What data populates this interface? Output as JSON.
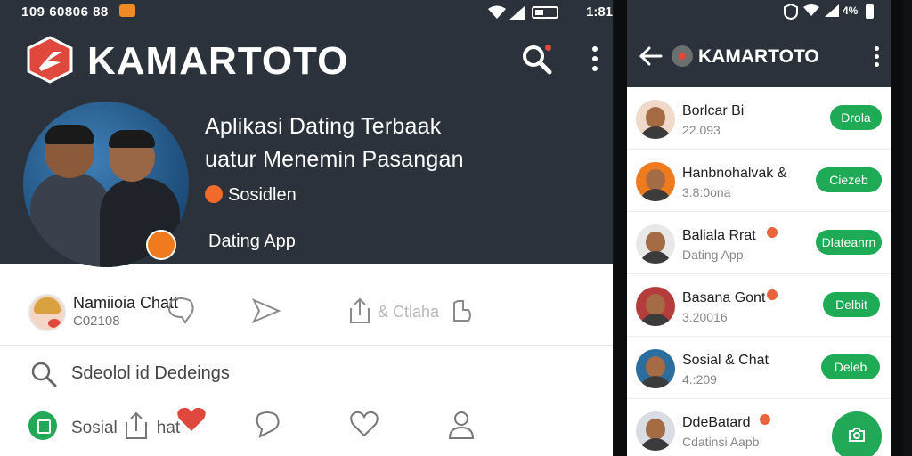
{
  "left": {
    "statusbar": {
      "time": "109 60806 88",
      "notification_color": "#f08a24"
    },
    "header": {
      "brand": "KAMARTOTO",
      "brand_color": "#e0483d",
      "bg_color": "#2c323b",
      "search_icon": "search-icon",
      "menu_icon": "kebab-menu-icon"
    },
    "profile": {
      "tagline_1": "Aplikasi Dating Terbaak",
      "tagline_2": "uatur Menemin Pasangan",
      "status_text": "Sosidlen",
      "category": "Dating App"
    },
    "row1": {
      "name": "Namiioia Chatt",
      "sub": "C02108",
      "share_label": "& Ctlaha"
    },
    "row2": {
      "search_text": "Sdeolol id Dedeings"
    },
    "bottom_nav": {
      "label": "Sosial",
      "label_suffix": "hat"
    }
  },
  "right": {
    "statusbar": {
      "time": "1:81",
      "battery_text": "4%"
    },
    "appbar": {
      "title": "KAMARTOTO"
    },
    "list": [
      {
        "name": "Borlcar Bi",
        "sub": "22.093",
        "button": "Drola",
        "badge": false,
        "avatar_color": "#f0d9c8"
      },
      {
        "name": "Hanbnohalvak &",
        "sub": "3.8:0ona",
        "button": "Ciezeb",
        "badge": false,
        "avatar_color": "#f07a1e"
      },
      {
        "name": "Baliala Rrat",
        "sub": "Dating App",
        "button": "Dlateanrn",
        "badge": true,
        "avatar_color": "#e8e8e8"
      },
      {
        "name": "Basana Gont",
        "sub": "3.20016",
        "button": "Delbit",
        "badge": true,
        "avatar_color": "#b43c3c"
      },
      {
        "name": "Sosial & Chat",
        "sub": "4.:209",
        "button": "Deleb",
        "badge": false,
        "avatar_color": "#2a6ea0"
      },
      {
        "name": "DdeBatard",
        "sub": "Cdatinsi Aapb",
        "button": "",
        "badge": true,
        "avatar_color": "#d8dde3"
      }
    ],
    "fab_icon": "camera-icon",
    "accent_color": "#1faa55"
  }
}
